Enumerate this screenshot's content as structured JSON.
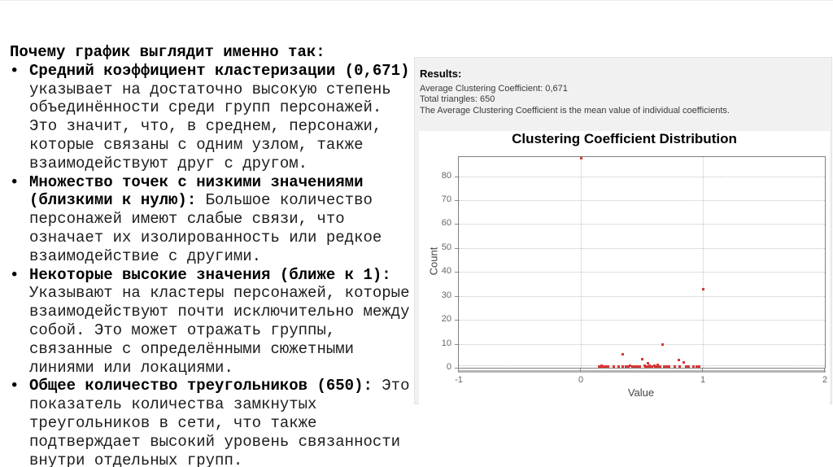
{
  "left_text": {
    "heading": "Почему график выглядит именно так:",
    "bullet_char": "•",
    "bullets": [
      {
        "lines": [
          [
            {
              "t": "Средний коэффициент кластеризации (0,671)",
              "b": true
            }
          ],
          [
            {
              "t": "указывает на достаточно высокую степень",
              "b": false
            }
          ],
          [
            {
              "t": "объединённости среди групп персонажей.",
              "b": false
            }
          ],
          [
            {
              "t": "Это значит, что, в среднем, персонажи,",
              "b": false
            }
          ],
          [
            {
              "t": "которые связаны с одним узлом, также",
              "b": false
            }
          ],
          [
            {
              "t": "взаимодействуют друг с другом.",
              "b": false
            }
          ]
        ]
      },
      {
        "lines": [
          [
            {
              "t": "Множество точек с низкими значениями",
              "b": true
            }
          ],
          [
            {
              "t": "(близкими к нулю):",
              "b": true
            },
            {
              "t": " Большое количество",
              "b": false
            }
          ],
          [
            {
              "t": "персонажей имеют слабые связи, что",
              "b": false
            }
          ],
          [
            {
              "t": "означает их изолированность или редкое",
              "b": false
            }
          ],
          [
            {
              "t": "взаимодействие с другими.",
              "b": false
            }
          ]
        ]
      },
      {
        "lines": [
          [
            {
              "t": "Некоторые высокие значения (ближе к 1):",
              "b": true
            }
          ],
          [
            {
              "t": "Указывают на кластеры персонажей, которые",
              "b": false
            }
          ],
          [
            {
              "t": "взаимодействуют почти исключительно между",
              "b": false
            }
          ],
          [
            {
              "t": "собой. Это может отражать группы,",
              "b": false
            }
          ],
          [
            {
              "t": "связанные с определёнными сюжетными",
              "b": false
            }
          ],
          [
            {
              "t": "линиями или локациями.",
              "b": false
            }
          ]
        ]
      },
      {
        "lines": [
          [
            {
              "t": "Общее количество треугольников (650):",
              "b": true
            },
            {
              "t": " Это",
              "b": false
            }
          ],
          [
            {
              "t": "показатель количества замкнутых",
              "b": false
            }
          ],
          [
            {
              "t": "треугольников в сети, что также",
              "b": false
            }
          ],
          [
            {
              "t": "подтверждает высокий уровень связанности",
              "b": false
            }
          ],
          [
            {
              "t": "внутри отдельных групп.",
              "b": false
            }
          ]
        ]
      }
    ]
  },
  "results_panel": {
    "title": "Results:",
    "lines": [
      "Average Clustering Coefficient: 0,671",
      "Total triangles: 650",
      "The Average Clustering Coefficient is the mean value of individual coefficients."
    ],
    "bg_color": "#f1f1f1"
  },
  "chart_data": {
    "type": "scatter",
    "title": "Clustering Coefficient Distribution",
    "xlabel": "Value",
    "ylabel": "Count",
    "xlim": [
      -1,
      2
    ],
    "ylim": [
      0,
      88
    ],
    "x_ticks": [
      -1,
      0,
      1,
      2
    ],
    "y_ticks": [
      0,
      10,
      20,
      30,
      40,
      50,
      60,
      70,
      80
    ],
    "grid": "dotted",
    "grid_x_at": [
      0,
      1
    ],
    "legend_position": "none",
    "marker": "square",
    "point_color": "#d93636",
    "points": [
      [
        0,
        87.5
      ],
      [
        1.0,
        32.8
      ],
      [
        0.67,
        9.7
      ],
      [
        0.34,
        5.6
      ],
      [
        0.5,
        3.5
      ],
      [
        0.8,
        3.4
      ],
      [
        0.84,
        2.3
      ],
      [
        0.55,
        1.8
      ],
      [
        0.63,
        1.2
      ],
      [
        0.6,
        0.9
      ],
      [
        0.15,
        0.6
      ],
      [
        0.16,
        0.5
      ],
      [
        0.17,
        0.7
      ],
      [
        0.18,
        0.5
      ],
      [
        0.19,
        0.6
      ],
      [
        0.2,
        0.5
      ],
      [
        0.22,
        0.6
      ],
      [
        0.27,
        0.5
      ],
      [
        0.31,
        0.6
      ],
      [
        0.34,
        0.5
      ],
      [
        0.37,
        0.6
      ],
      [
        0.39,
        0.5
      ],
      [
        0.4,
        0.7
      ],
      [
        0.42,
        0.5
      ],
      [
        0.44,
        0.6
      ],
      [
        0.46,
        0.5
      ],
      [
        0.48,
        0.6
      ],
      [
        0.52,
        0.7
      ],
      [
        0.53,
        0.5
      ],
      [
        0.54,
        0.6
      ],
      [
        0.55,
        0.5
      ],
      [
        0.56,
        0.7
      ],
      [
        0.57,
        0.5
      ],
      [
        0.58,
        0.6
      ],
      [
        0.61,
        0.5
      ],
      [
        0.63,
        0.6
      ],
      [
        0.65,
        0.5
      ],
      [
        0.68,
        0.6
      ],
      [
        0.7,
        0.5
      ],
      [
        0.72,
        0.6
      ],
      [
        0.77,
        0.5
      ],
      [
        0.81,
        0.6
      ],
      [
        0.86,
        0.5
      ],
      [
        0.88,
        0.6
      ],
      [
        0.92,
        0.5
      ],
      [
        0.95,
        0.6
      ],
      [
        0.97,
        0.5
      ]
    ]
  }
}
